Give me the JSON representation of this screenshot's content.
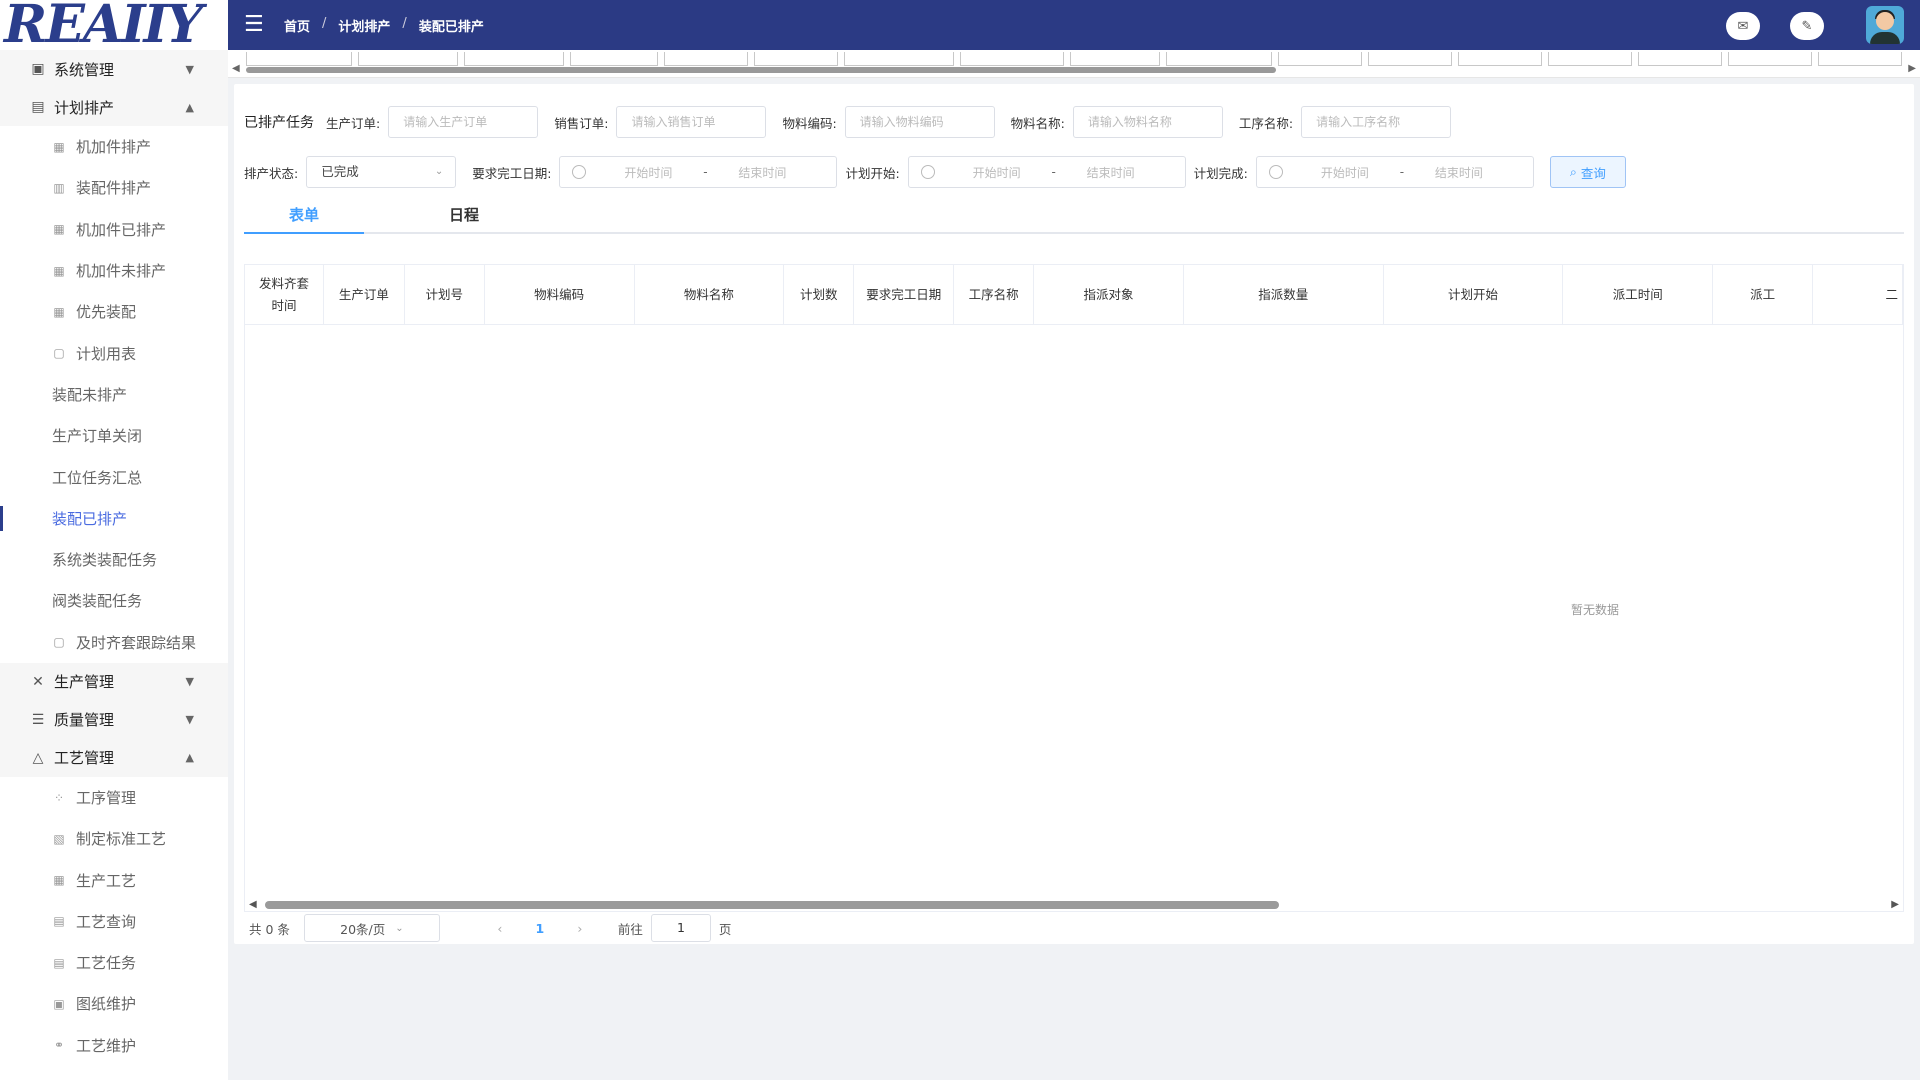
{
  "logo": "REAIIY",
  "sidebar": {
    "groups": [
      {
        "label": "系统管理",
        "icon": "monitor-icon",
        "expanded": false
      },
      {
        "label": "计划排产",
        "icon": "document-icon",
        "expanded": true
      },
      {
        "label": "生产管理",
        "icon": "tools-icon",
        "expanded": false
      },
      {
        "label": "质量管理",
        "icon": "list-icon",
        "expanded": false
      },
      {
        "label": "工艺管理",
        "icon": "flask-icon",
        "expanded": true
      }
    ],
    "plan_items": [
      "机加件排产",
      "装配件排产",
      "机加件已排产",
      "机加件未排产",
      "优先装配",
      "计划用表",
      "装配未排产",
      "生产订单关闭",
      "工位任务汇总",
      "装配已排产",
      "系统类装配任务",
      "阀类装配任务",
      "及时齐套跟踪结果"
    ],
    "craft_items": [
      "工序管理",
      "制定标准工艺",
      "生产工艺",
      "工艺查询",
      "工艺任务",
      "图纸维护",
      "工艺维护"
    ]
  },
  "header": {
    "breadcrumb": [
      "首页",
      "计划排产",
      "装配已排产"
    ]
  },
  "form": {
    "title": "已排产任务",
    "labels": {
      "prod_order": "生产订单:",
      "sales_order": "销售订单:",
      "material_code": "物料编码:",
      "material_name": "物料名称:",
      "process_name": "工序名称:",
      "status": "排产状态:",
      "due_date": "要求完工日期:",
      "plan_start": "计划开始:",
      "plan_finish": "计划完成:"
    },
    "placeholders": {
      "prod_order": "请输入生产订单",
      "sales_order": "请输入销售订单",
      "material_code": "请输入物料编码",
      "material_name": "请输入物料名称",
      "process_name": "请输入工序名称",
      "start_time": "开始时间",
      "end_time": "结束时间"
    },
    "status_value": "已完成",
    "range_sep": "-",
    "query_label": "查询"
  },
  "tabs": [
    "表单",
    "日程"
  ],
  "table": {
    "columns": [
      "发料齐套\n时间",
      "生产订单",
      "计划号",
      "物料编码",
      "物料名称",
      "计划数",
      "要求完工日期",
      "工序名称",
      "指派对象",
      "指派数量",
      "计划开始",
      "派工时间",
      "派工",
      "二"
    ],
    "empty_text": "暂无数据"
  },
  "pager": {
    "total_text": "共 0 条",
    "page_size": "20条/页",
    "current_page": "1",
    "goto_label": "前往",
    "goto_value": "1",
    "page_suffix": "页"
  },
  "colors": {
    "header_bg": "#2b3a84",
    "accent": "#409eff",
    "active_menu": "#4a6be0"
  }
}
